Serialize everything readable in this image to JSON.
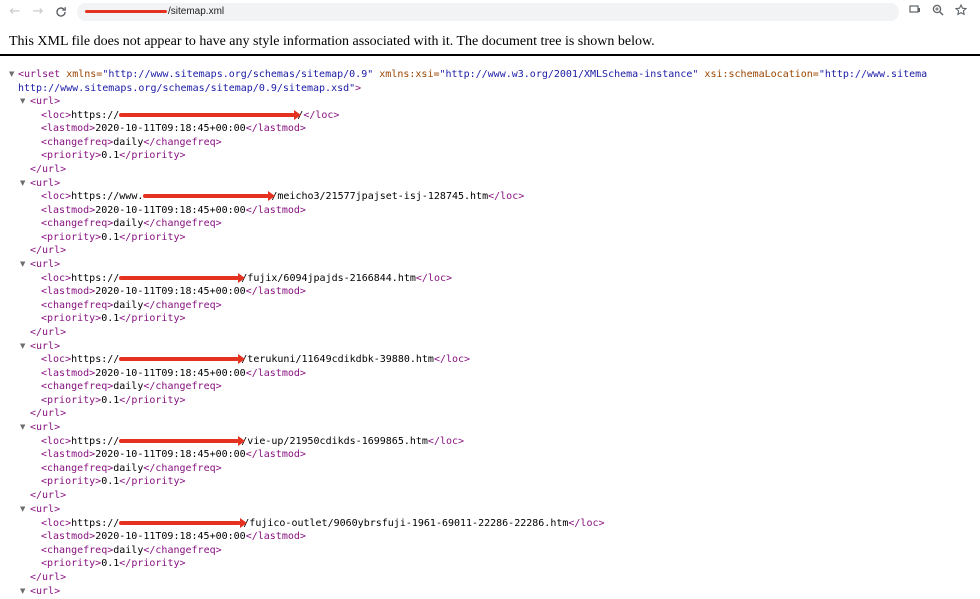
{
  "toolbar": {
    "url_path": "/sitemap.xml",
    "back_glyph": "←",
    "forward_glyph": "→",
    "reload_glyph": "C",
    "icons": [
      "back-icon",
      "forward-icon",
      "reload-icon",
      "info-icon",
      "cast-icon",
      "zoom-icon",
      "star-icon"
    ]
  },
  "notice": "This XML file does not appear to have any style information associated with it. The document tree is shown below.",
  "urlset": {
    "open_tag": "<urlset",
    "attr1_name": "xmlns=",
    "attr1_value": "\"http://www.sitemaps.org/schemas/sitemap/0.9\"",
    "attr2_name": "xmlns:xsi=",
    "attr2_value": "\"http://www.w3.org/2001/XMLSchema-instance\"",
    "attr3_name": "xsi:schemaLocation=",
    "attr3_value_start": "\"http://www.sitema",
    "attr3_value_cont": "http://www.sitemaps.org/schemas/sitemap/0.9/sitemap.xsd\"",
    "open_tag_end": ">"
  },
  "tags": {
    "url_open": "<url>",
    "url_close": "</url>",
    "loc_open": "<loc>",
    "loc_close": "</loc>",
    "lastmod_open": "<lastmod>",
    "lastmod_close": "</lastmod>",
    "changefreq_open": "<changefreq>",
    "changefreq_close": "</changefreq>",
    "priority_open": "<priority>",
    "priority_close": "</priority>"
  },
  "urls": [
    {
      "loc_prefix": "https://",
      "loc_path": "/",
      "lastmod": "2020-10-11T09:18:45+00:00",
      "changefreq": "daily",
      "priority": "0.1"
    },
    {
      "loc_prefix": "https://www.",
      "loc_path": "/meicho3/21577jpajset-isj-128745.htm",
      "lastmod": "2020-10-11T09:18:45+00:00",
      "changefreq": "daily",
      "priority": "0.1"
    },
    {
      "loc_prefix": "https://",
      "loc_path": "/fujix/6094jpajds-2166844.htm",
      "lastmod": "2020-10-11T09:18:45+00:00",
      "changefreq": "daily",
      "priority": "0.1"
    },
    {
      "loc_prefix": "https://",
      "loc_path": "/terukuni/11649cdikdbk-39880.htm",
      "lastmod": "2020-10-11T09:18:45+00:00",
      "changefreq": "daily",
      "priority": "0.1"
    },
    {
      "loc_prefix": "https://",
      "loc_path": "/vie-up/21950cdikds-1699865.htm",
      "lastmod": "2020-10-11T09:18:45+00:00",
      "changefreq": "daily",
      "priority": "0.1"
    },
    {
      "loc_prefix": "https://",
      "loc_path": "/fujico-outlet/9060ybrsfuji-1961-69011-22286-22286.htm",
      "lastmod": "2020-10-11T09:18:45+00:00",
      "changefreq": "daily",
      "priority": "0.1"
    }
  ]
}
